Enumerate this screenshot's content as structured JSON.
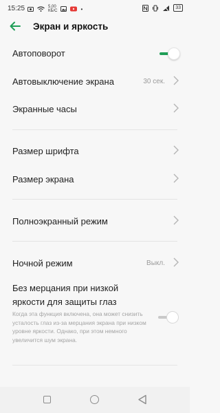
{
  "status_bar": {
    "time": "15:25",
    "speed_value": "5,00",
    "speed_unit": "КБ/С",
    "battery": "33"
  },
  "header": {
    "title": "Экран и яркость"
  },
  "settings": {
    "auto_rotate": {
      "label": "Автоповорот",
      "enabled": true
    },
    "screen_timeout": {
      "label": "Автовыключение экрана",
      "value": "30 сек."
    },
    "screen_clock": {
      "label": "Экранные часы"
    },
    "font_size": {
      "label": "Размер шрифта"
    },
    "display_size": {
      "label": "Размер экрана"
    },
    "fullscreen_mode": {
      "label": "Полноэкранный режим"
    },
    "night_mode": {
      "label": "Ночной режим",
      "value": "Выкл."
    },
    "flicker_free": {
      "label": "Без мерцания при низкой яркости для защиты глаз",
      "description": "Когда эта функция включена, она может снизить усталость глаз из-за мерцания экрана при низком уровне яркости. Однако, при этом немного увеличится шум экрана.",
      "enabled": false
    }
  },
  "colors": {
    "accent": "#1f9e57",
    "background": "#f7f7f7",
    "secondary_text": "#9a9a9a"
  },
  "icons": {
    "back": "arrow-left-icon",
    "chevron": "chevron-right-icon"
  }
}
